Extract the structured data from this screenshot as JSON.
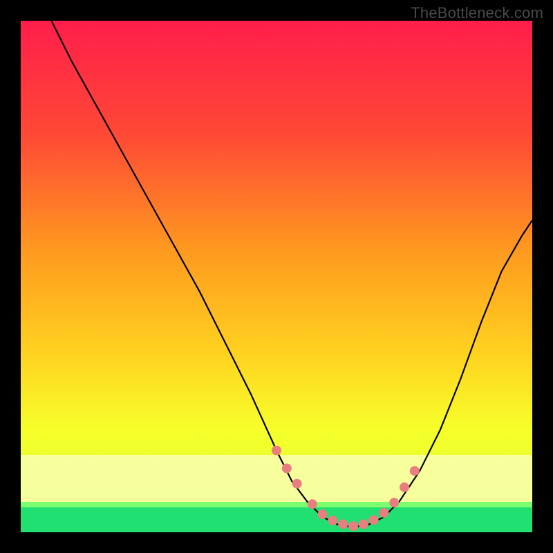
{
  "watermark": "TheBottleneck.com",
  "chart_data": {
    "type": "line",
    "title": "",
    "xlabel": "",
    "ylabel": "",
    "xlim": [
      0,
      100
    ],
    "ylim": [
      0,
      100
    ],
    "grid": false,
    "legend": false,
    "background_gradient": {
      "top": "#ff1e4b",
      "mid1": "#ff6a2a",
      "mid2": "#ffd21f",
      "mid3": "#f6ff2a",
      "band": "#f9ffb0",
      "bottom": "#1fe070"
    },
    "series": [
      {
        "name": "curve",
        "x": [
          6,
          10,
          15,
          20,
          25,
          30,
          35,
          40,
          45,
          50,
          53,
          56,
          59,
          62,
          65,
          68,
          71,
          74,
          78,
          82,
          86,
          90,
          94,
          98,
          100
        ],
        "y": [
          100,
          92,
          83,
          74,
          65,
          56,
          47,
          37,
          27,
          16,
          10,
          6,
          3,
          1.5,
          1,
          1.5,
          3,
          6,
          12,
          20,
          30,
          41,
          51,
          58,
          61
        ]
      }
    ],
    "markers": {
      "name": "dots",
      "color": "#e97e80",
      "x": [
        50,
        52,
        54,
        57,
        59,
        61,
        63,
        65,
        67,
        69,
        71,
        73,
        75,
        77
      ],
      "y": [
        16,
        12.5,
        9.5,
        5.5,
        3.5,
        2.3,
        1.6,
        1.2,
        1.6,
        2.4,
        3.8,
        5.8,
        8.8,
        12
      ]
    }
  }
}
